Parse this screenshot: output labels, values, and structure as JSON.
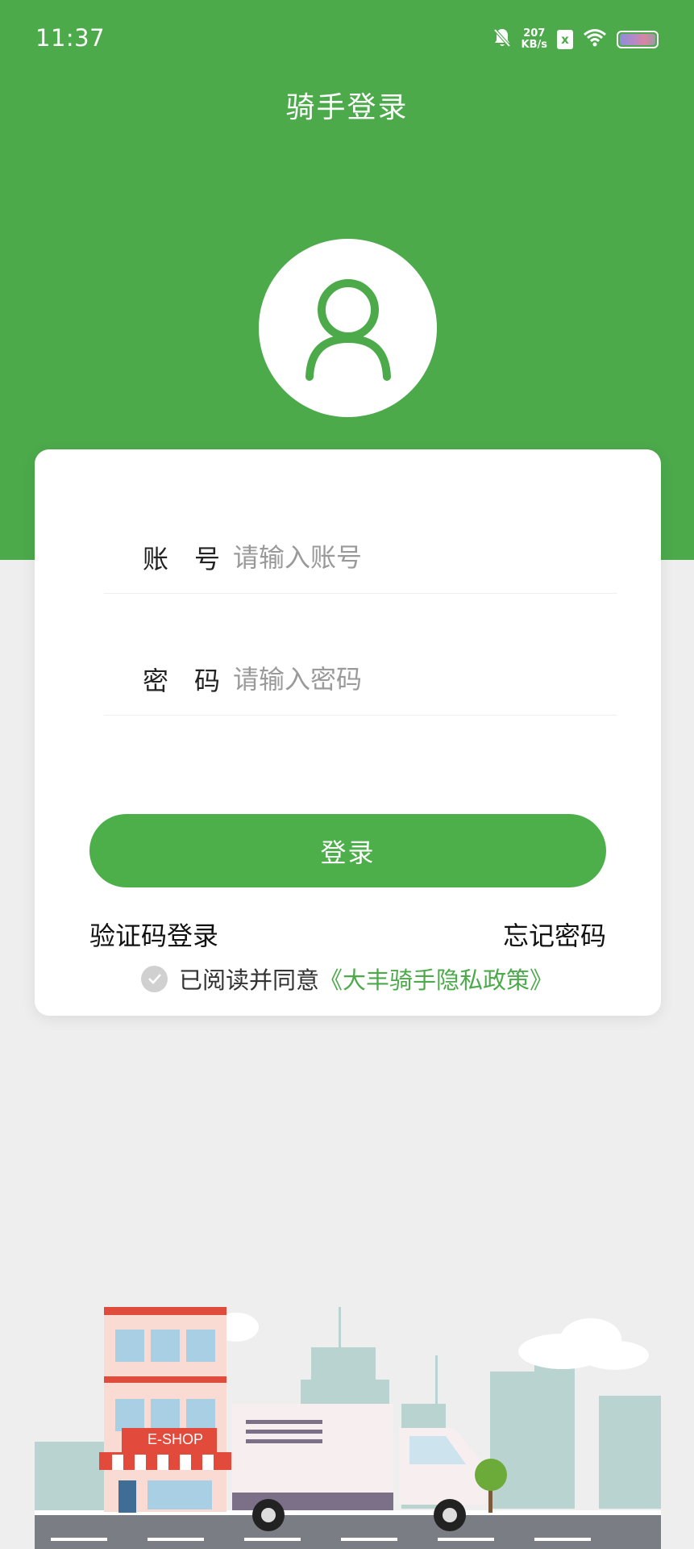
{
  "status_bar": {
    "time": "11:37",
    "net_speed_value": "207",
    "net_speed_unit": "KB/s",
    "sim_label": "x",
    "icons": [
      "mute-bell-icon",
      "sim-icon",
      "wifi-icon",
      "battery-icon"
    ]
  },
  "header": {
    "title": "骑手登录"
  },
  "form": {
    "account_label": "账　号",
    "account_placeholder": "请输入账号",
    "password_label": "密　码",
    "password_placeholder": "请输入密码",
    "login_button": "登录",
    "sms_login_link": "验证码登录",
    "forgot_password_link": "忘记密码",
    "agreement_text": "已阅读并同意",
    "agreement_link": "《大丰骑手隐私政策》"
  },
  "illustration": {
    "shop_sign": "E-SHOP"
  },
  "colors": {
    "brand_green": "#4caa4b",
    "button_green": "#4caf4a",
    "background": "#eeeeee"
  }
}
